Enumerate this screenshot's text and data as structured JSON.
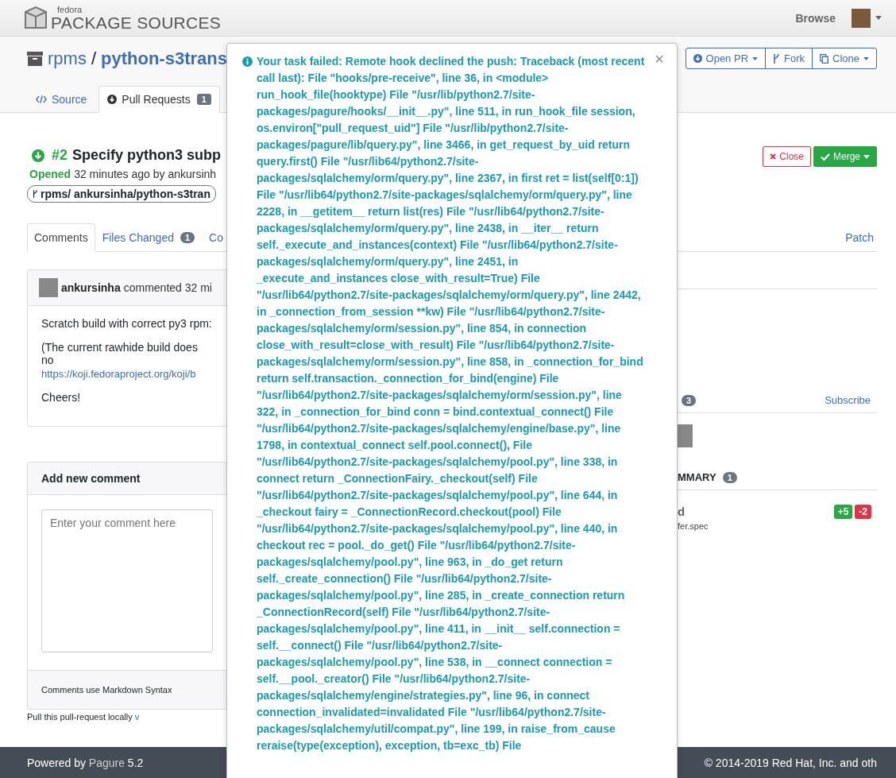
{
  "header": {
    "brand_small": "fedora",
    "brand": "PACKAGE SOURCES",
    "nav": [
      {
        "label": "Browse"
      }
    ]
  },
  "repo": {
    "namespace": "rpms",
    "separator": "/",
    "name": "python-s3trans"
  },
  "repo_actions": [
    {
      "label": "Open PR",
      "kind": "pr",
      "caret": true
    },
    {
      "label": "Fork",
      "kind": "fork",
      "caret": false
    },
    {
      "label": "Clone",
      "kind": "clone",
      "caret": true
    }
  ],
  "repo_tabs": [
    {
      "label": "Source",
      "kind": "code",
      "selected": false
    },
    {
      "label": "Pull Requests",
      "kind": "pr",
      "badge": "1",
      "selected": true
    }
  ],
  "pr": {
    "number": "#2",
    "title": "Specify python3 subp",
    "status": "Opened",
    "meta": "32 minutes ago by ankursinh",
    "branch": "rpms/ ankursinha/python-s3tran"
  },
  "pr_actions": [
    {
      "label": "Close",
      "kind": "close"
    },
    {
      "label": "Merge",
      "kind": "merge"
    }
  ],
  "pr_tabs": [
    {
      "label": "Comments",
      "selected": true
    },
    {
      "label": "Files Changed",
      "badge": "1",
      "selected": false
    },
    {
      "label": "Co",
      "selected": false
    }
  ],
  "patch_link": "Patch",
  "comment": {
    "author": "ankursinha",
    "meta": "commented 32 mi",
    "lines": [
      "Scratch build with correct py3 rpm:",
      "(The current rawhide build does no"
    ],
    "link": "https://koji.fedoraproject.org/koji/b",
    "closing": "Cheers!"
  },
  "new_comment": {
    "title": "Add new comment",
    "placeholder": "Enter your comment here",
    "hint": "Comments use Markdown Syntax"
  },
  "pull_locally": {
    "text": "Pull this pull-request locally",
    "toggle": "v"
  },
  "sidebar": {
    "subscribers_count": "3",
    "subscribe": "Subscribe",
    "summary_title": "MMARY",
    "summary_count": "1",
    "file_fragment": "d",
    "path_fragment": "fer.spec",
    "added": "+5",
    "removed": "-2"
  },
  "footer": {
    "powered": "Powered by",
    "app": "Pagure",
    "version": "5.2",
    "copyright": "© 2014-2019 Red Hat, Inc. and oth"
  },
  "alert": {
    "message": "Your task failed: Remote hook declined the push: Traceback (most recent call last): File \"hooks/pre-receive\", line 36, in <module> run_hook_file(hooktype) File \"/usr/lib/python2.7/site-packages/pagure/hooks/__init__.py\", line 511, in run_hook_file session, os.environ[\"pull_request_uid\"] File \"/usr/lib/python2.7/site-packages/pagure/lib/query.py\", line 3466, in get_request_by_uid return query.first() File \"/usr/lib64/python2.7/site-packages/sqlalchemy/orm/query.py\", line 2367, in first ret = list(self[0:1]) File \"/usr/lib64/python2.7/site-packages/sqlalchemy/orm/query.py\", line 2228, in __getitem__ return list(res) File \"/usr/lib64/python2.7/site-packages/sqlalchemy/orm/query.py\", line 2438, in __iter__ return self._execute_and_instances(context) File \"/usr/lib64/python2.7/site-packages/sqlalchemy/orm/query.py\", line 2451, in _execute_and_instances close_with_result=True) File \"/usr/lib64/python2.7/site-packages/sqlalchemy/orm/query.py\", line 2442, in _connection_from_session **kw) File \"/usr/lib64/python2.7/site-packages/sqlalchemy/orm/session.py\", line 854, in connection close_with_result=close_with_result) File \"/usr/lib64/python2.7/site-packages/sqlalchemy/orm/session.py\", line 858, in _connection_for_bind return self.transaction._connection_for_bind(engine) File \"/usr/lib64/python2.7/site-packages/sqlalchemy/orm/session.py\", line 322, in _connection_for_bind conn = bind.contextual_connect() File \"/usr/lib64/python2.7/site-packages/sqlalchemy/engine/base.py\", line 1798, in contextual_connect self.pool.connect(), File \"/usr/lib64/python2.7/site-packages/sqlalchemy/pool.py\", line 338, in connect return _ConnectionFairy._checkout(self) File \"/usr/lib64/python2.7/site-packages/sqlalchemy/pool.py\", line 644, in _checkout fairy = _ConnectionRecord.checkout(pool) File \"/usr/lib64/python2.7/site-packages/sqlalchemy/pool.py\", line 440, in checkout rec = pool._do_get() File \"/usr/lib64/python2.7/site-packages/sqlalchemy/pool.py\", line 963, in _do_get return self._create_connection() File \"/usr/lib64/python2.7/site-packages/sqlalchemy/pool.py\", line 285, in _create_connection return _ConnectionRecord(self) File \"/usr/lib64/python2.7/site-packages/sqlalchemy/pool.py\", line 411, in __init__ self.connection = self.__connect() File \"/usr/lib64/python2.7/site-packages/sqlalchemy/pool.py\", line 538, in __connect connection = self.__pool._creator() File \"/usr/lib64/python2.7/site-packages/sqlalchemy/engine/strategies.py\", line 96, in connect connection_invalidated=invalidated File \"/usr/lib64/python2.7/site-packages/sqlalchemy/util/compat.py\", line 199, in raise_from_cause reraise(type(exception), exception, tb=exc_tb) File",
    "dismiss": "×"
  }
}
